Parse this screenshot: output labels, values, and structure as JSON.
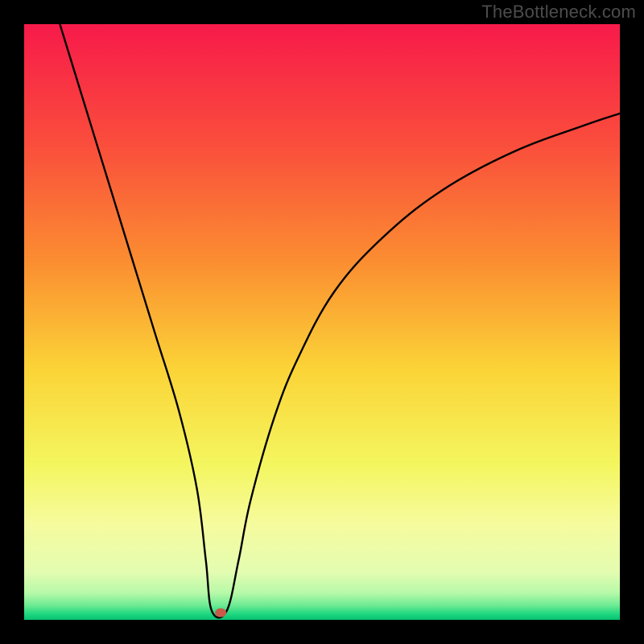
{
  "watermark": "TheBottleneck.com",
  "chart_data": {
    "type": "line",
    "title": "",
    "xlabel": "",
    "ylabel": "",
    "xlim": [
      0,
      100
    ],
    "ylim": [
      0,
      100
    ],
    "background": {
      "type": "vertical-gradient",
      "description": "Rainbow gradient from red (top, high values) through orange and yellow to green (bottom, low values), indicating optimal region near the bottom.",
      "stops": [
        {
          "offset": 0.0,
          "color": "#f71a4a"
        },
        {
          "offset": 0.2,
          "color": "#fa4d3c"
        },
        {
          "offset": 0.4,
          "color": "#fb8e31"
        },
        {
          "offset": 0.58,
          "color": "#fbd437"
        },
        {
          "offset": 0.74,
          "color": "#f4f65f"
        },
        {
          "offset": 0.84,
          "color": "#f6fb9e"
        },
        {
          "offset": 0.92,
          "color": "#e3fcb1"
        },
        {
          "offset": 0.955,
          "color": "#b6f9a8"
        },
        {
          "offset": 0.975,
          "color": "#70eb94"
        },
        {
          "offset": 0.99,
          "color": "#1fd880"
        },
        {
          "offset": 1.0,
          "color": "#06c171"
        }
      ]
    },
    "marker": {
      "x": 33,
      "y": 1.2,
      "color": "#c85a4a",
      "description": "Optimal/current configuration point near the valley minimum"
    },
    "series": [
      {
        "name": "bottleneck-curve",
        "description": "V-shaped curve reaching a minimum near x≈32 then rising asymptotically toward the right.",
        "x": [
          6,
          10,
          14,
          18,
          22,
          26,
          29,
          30.5,
          31.5,
          34,
          36,
          38,
          42,
          46,
          52,
          60,
          70,
          82,
          94,
          100
        ],
        "y": [
          100,
          87,
          74,
          61,
          48,
          35,
          22,
          10,
          1.5,
          1.5,
          10,
          20,
          34,
          44,
          55,
          64,
          72,
          78.5,
          83,
          85
        ]
      }
    ]
  }
}
